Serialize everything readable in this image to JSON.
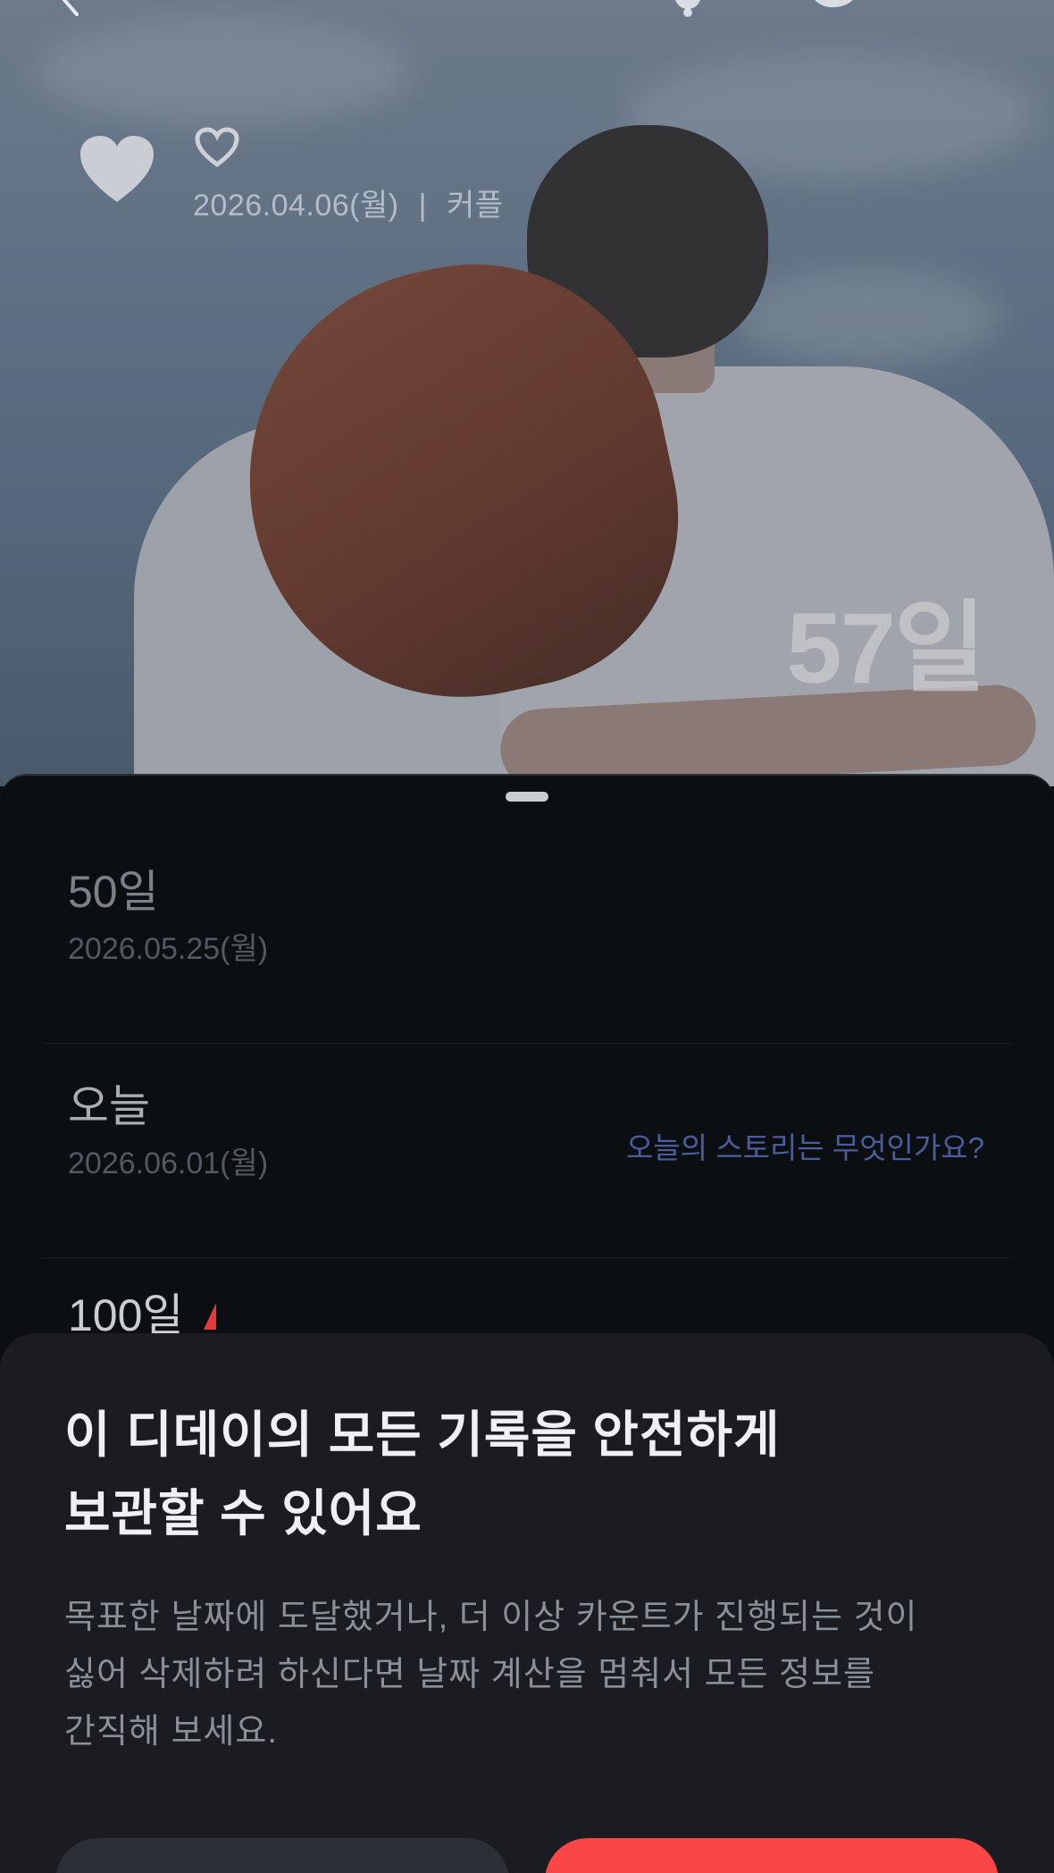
{
  "hero": {
    "date_line": "2026.04.06(월)",
    "separator": "|",
    "category": "커플",
    "day_count": "57일"
  },
  "list": {
    "rows": [
      {
        "title": "50일",
        "date": "2026.05.25(월)"
      },
      {
        "title": "오늘",
        "date": "2026.06.01(월)",
        "action": "오늘의 스토리는 무엇인가요?"
      },
      {
        "title": "100일"
      }
    ]
  },
  "modal": {
    "title_line1": "이 디데이의 모든 기록을 안전하게",
    "title_line2": "보관할 수 있어요",
    "body_line1": "목표한 날짜에 도달했거나, 더 이상 카운트가 진행되는 것이",
    "body_line2": "싫어 삭제하려 하신다면 날짜 계산을 멈춰서 모든 정보를",
    "body_line3": "간직해 보세요."
  },
  "colors": {
    "accent_red": "#fa4646",
    "link_blue": "#4b5d9f",
    "modal_bg": "#1b1c21",
    "sheet_bg": "#0b0f12"
  },
  "icons": [
    "back-icon",
    "bell-icon",
    "palette-icon",
    "heart-icon",
    "heart-outline-icon"
  ]
}
